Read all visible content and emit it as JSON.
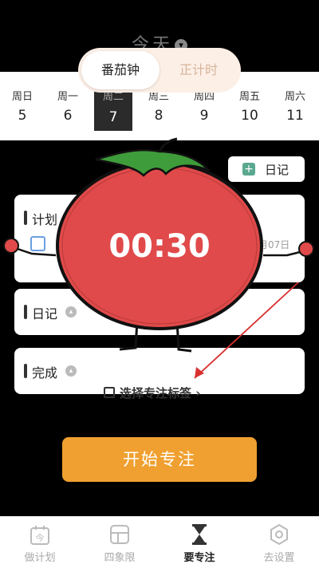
{
  "header": {
    "title": "今天"
  },
  "mode_switch": {
    "pomodoro": "番茄钟",
    "stopwatch": "正计时"
  },
  "week": [
    {
      "name": "周日",
      "date": "5"
    },
    {
      "name": "周一",
      "date": "6"
    },
    {
      "name": "周二",
      "date": "7"
    },
    {
      "name": "周三",
      "date": "8"
    },
    {
      "name": "周四",
      "date": "9"
    },
    {
      "name": "周五",
      "date": "10"
    },
    {
      "name": "周六",
      "date": "11"
    }
  ],
  "diary_button": {
    "label": "日记"
  },
  "cards": {
    "plan": {
      "title": "计划",
      "date": "月07日"
    },
    "diary": {
      "title": "日记"
    },
    "done": {
      "title": "完成"
    }
  },
  "timer": {
    "value": "00:30"
  },
  "focus_tag": {
    "label": "选择专注标签"
  },
  "start_button": {
    "label": "开始专注"
  },
  "tabs": [
    {
      "label": "做计划",
      "icon": "calendar-icon"
    },
    {
      "label": "四象限",
      "icon": "grid-icon"
    },
    {
      "label": "要专注",
      "icon": "hourglass-icon"
    },
    {
      "label": "去设置",
      "icon": "settings-icon"
    }
  ],
  "calendar_icon_text": "今",
  "colors": {
    "accent": "#f0a030",
    "tomato": "#e04a4a",
    "leaf": "#3f9c3a",
    "diary_plus": "#5aa88f"
  }
}
